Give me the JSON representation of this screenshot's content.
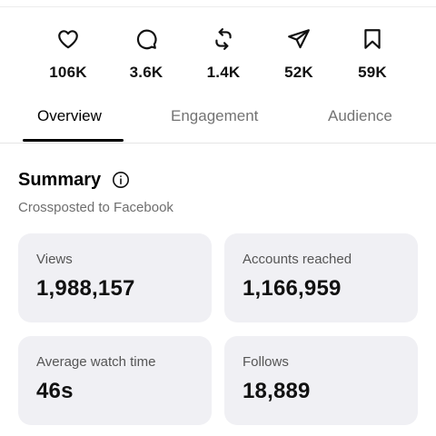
{
  "stats": [
    {
      "icon": "heart-icon",
      "value": "106K"
    },
    {
      "icon": "comment-icon",
      "value": "3.6K"
    },
    {
      "icon": "repost-icon",
      "value": "1.4K"
    },
    {
      "icon": "share-icon",
      "value": "52K"
    },
    {
      "icon": "bookmark-icon",
      "value": "59K"
    }
  ],
  "tabs": [
    {
      "label": "Overview",
      "active": true
    },
    {
      "label": "Engagement",
      "active": false
    },
    {
      "label": "Audience",
      "active": false
    }
  ],
  "summary": {
    "title": "Summary",
    "info_icon": "info-icon",
    "subtitle": "Crossposted to Facebook"
  },
  "metrics": [
    {
      "label": "Views",
      "value": "1,988,157"
    },
    {
      "label": "Accounts reached",
      "value": "1,166,959"
    },
    {
      "label": "Average watch time",
      "value": "46s"
    },
    {
      "label": "Follows",
      "value": "18,889"
    }
  ],
  "colors": {
    "card_background": "#f0f0f4",
    "inactive_tab": "#737373",
    "active_indicator": "#000000"
  }
}
